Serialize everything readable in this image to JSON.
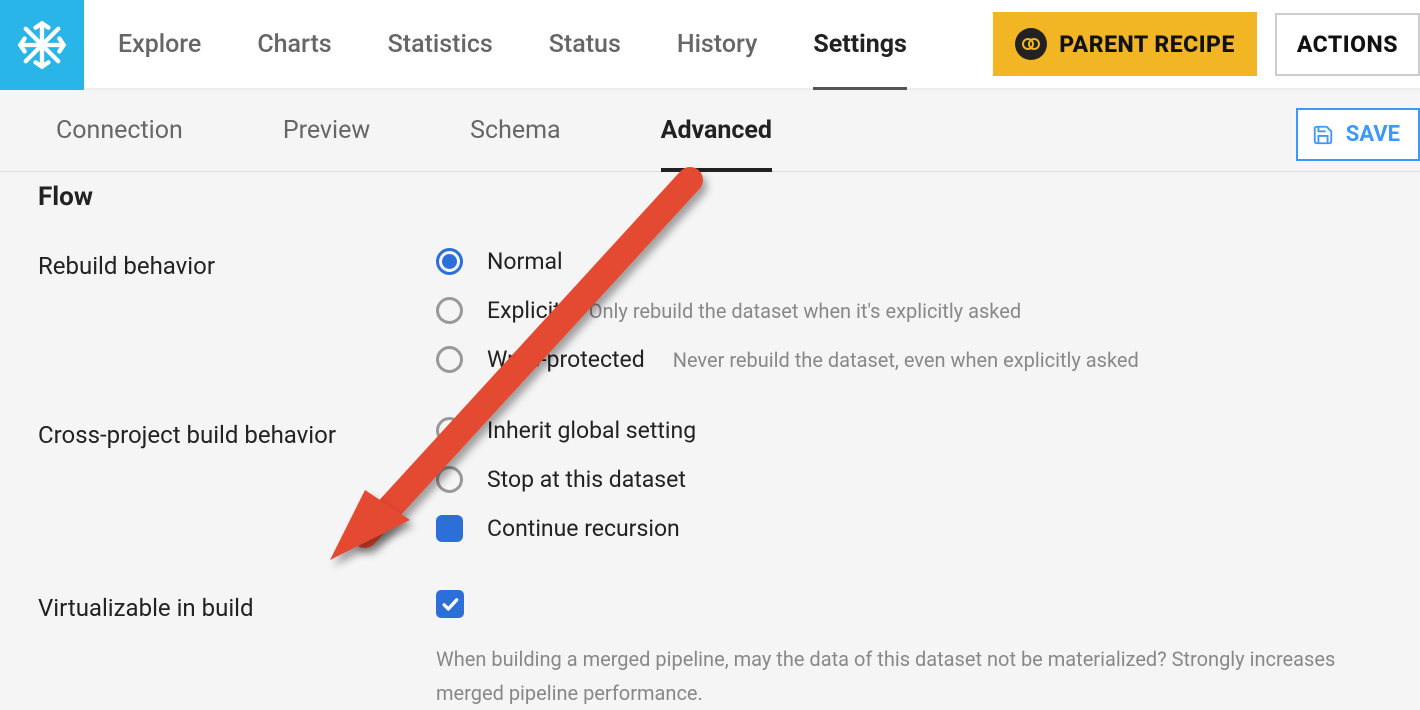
{
  "topTabs": {
    "explore": "Explore",
    "charts": "Charts",
    "statistics": "Statistics",
    "status": "Status",
    "history": "History",
    "settings": "Settings"
  },
  "buttons": {
    "parentRecipe": "PARENT RECIPE",
    "actions": "ACTIONS",
    "save": "SAVE"
  },
  "subTabs": {
    "connection": "Connection",
    "preview": "Preview",
    "schema": "Schema",
    "advanced": "Advanced"
  },
  "flow": {
    "heading": "Flow",
    "rebuildBehavior": {
      "label": "Rebuild behavior",
      "options": {
        "normal": "Normal",
        "explicit": "Explicit",
        "explicitHint": "Only rebuild the dataset when it's explicitly asked",
        "writeProtected": "Write-protected",
        "writeProtectedHint": "Never rebuild the dataset, even when explicitly asked"
      }
    },
    "crossProject": {
      "label": "Cross-project build behavior",
      "options": {
        "inherit": "Inherit global setting",
        "stop": "Stop at this dataset",
        "continue": "Continue recursion"
      }
    },
    "virtualizable": {
      "label": "Virtualizable in build",
      "hint": "When building a merged pipeline, may the data of this dataset not be materialized? Strongly increases merged pipeline performance."
    }
  }
}
